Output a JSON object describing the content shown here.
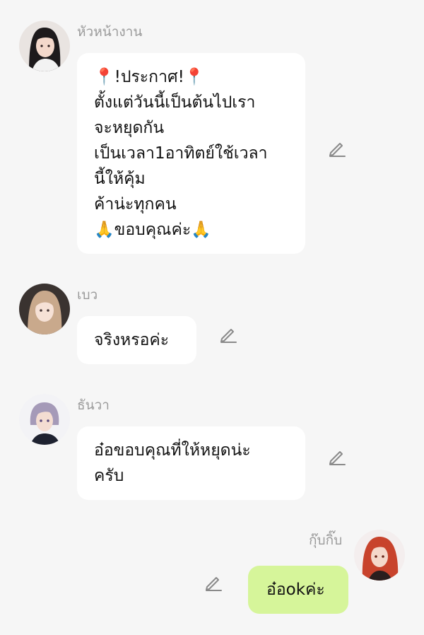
{
  "messages": [
    {
      "sender": "หัวหน้างาน",
      "text": "📍!ประกาศ!📍\nตั้งแต่วันนี้เป็นต้นไปเรา\nจะหยุดกัน\nเป็นเวลา1อาทิตย์ใช้เวลา\nนี้ให้คุ้ม\nค้าน่ะทุกคน\n🙏ขอบคุณค่ะ🙏",
      "avatar_icon": "woman-dark-hair-avatar-icon"
    },
    {
      "sender": "เบว",
      "text": "จริงหรอค่ะ",
      "avatar_icon": "woman-blonde-hair-avatar-icon"
    },
    {
      "sender": "ธันวา",
      "text": "อ๋อขอบคุณที่ให้หยุดน่ะ\nครับ",
      "avatar_icon": "man-purple-hair-avatar-icon"
    },
    {
      "sender": "กุ๊บกิ๊บ",
      "text": "อ๋อokค่ะ",
      "avatar_icon": "woman-red-hair-avatar-icon"
    }
  ],
  "colors": {
    "background": "#f6f6f6",
    "incoming_bubble": "#ffffff",
    "outgoing_bubble": "#d6f59a",
    "sender_name": "#9a9a9a",
    "edit_icon": "#8a8a8a"
  }
}
